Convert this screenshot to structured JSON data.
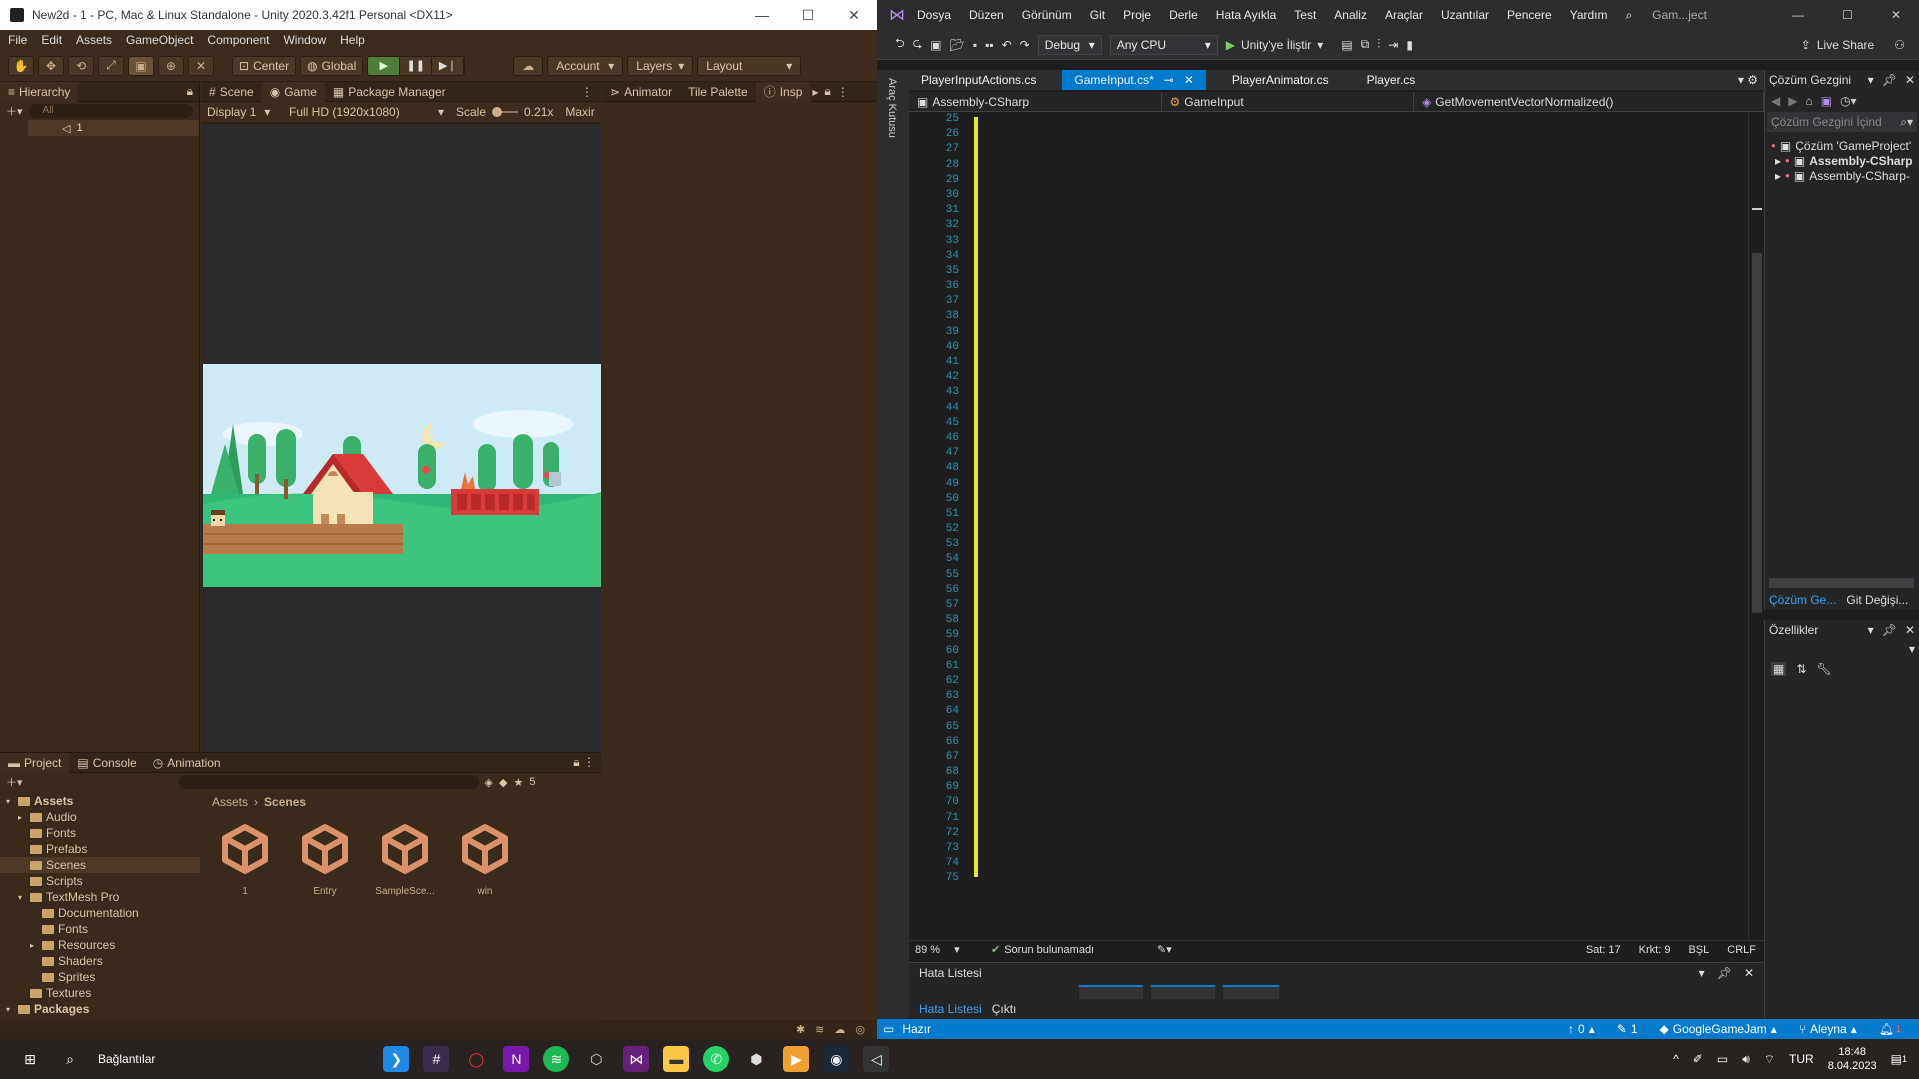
{
  "unity": {
    "title": "New2d - 1 - PC, Mac & Linux Standalone - Unity 2020.3.42f1 Personal <DX11>",
    "menu": [
      "File",
      "Edit",
      "Assets",
      "GameObject",
      "Component",
      "Window",
      "Help"
    ],
    "toolbar": {
      "center": "Center",
      "global": "Global",
      "account": "Account",
      "layers": "Layers",
      "layout": "Layout"
    },
    "hierarchy": {
      "tab": "Hierarchy",
      "search_placeholder": "All",
      "scene_item": "1"
    },
    "center_tabs": [
      "Scene",
      "Game",
      "Package Manager"
    ],
    "game_bar": {
      "display": "Display 1",
      "resolution": "Full HD (1920x1080)",
      "scale_label": "Scale",
      "scale_value": "0.21x",
      "maximize": "Maxir"
    },
    "right_tabs": [
      "Animator",
      "Tile Palette",
      "Insp"
    ],
    "bottom_tabs": [
      "Project",
      "Console",
      "Animation"
    ],
    "hidden_count": "5",
    "project_tree": [
      {
        "label": "Assets",
        "level": 0,
        "bold": true
      },
      {
        "label": "Audio",
        "level": 1
      },
      {
        "label": "Fonts",
        "level": 1
      },
      {
        "label": "Prefabs",
        "level": 1
      },
      {
        "label": "Scenes",
        "level": 1,
        "selected": true
      },
      {
        "label": "Scripts",
        "level": 1
      },
      {
        "label": "TextMesh Pro",
        "level": 1
      },
      {
        "label": "Documentation",
        "level": 2
      },
      {
        "label": "Fonts",
        "level": 2
      },
      {
        "label": "Resources",
        "level": 2
      },
      {
        "label": "Shaders",
        "level": 2
      },
      {
        "label": "Sprites",
        "level": 2
      },
      {
        "label": "Textures",
        "level": 1
      },
      {
        "label": "Packages",
        "level": 0,
        "bold": true
      }
    ],
    "breadcrumb": [
      "Assets",
      "Scenes"
    ],
    "scenes": [
      "1",
      "Entry",
      "SampleSce...",
      "win"
    ]
  },
  "vs": {
    "menu": [
      "Dosya",
      "Düzen",
      "Görünüm",
      "Git",
      "Proje",
      "Derle",
      "Hata Ayıkla",
      "Test",
      "Analiz",
      "Araçlar",
      "Uzantılar",
      "Pencere",
      "Yardım"
    ],
    "search_label": "Gam...ject",
    "config": "Debug",
    "platform": "Any CPU",
    "attach": "Unity'ye İliştir",
    "live_share": "Live Share",
    "toolbox": "Araç Kutusu",
    "doc_tabs": [
      {
        "label": "PlayerInputActions.cs",
        "selected": false
      },
      {
        "label": "GameInput.cs*",
        "selected": true
      },
      {
        "label": "PlayerAnimator.cs",
        "selected": false
      },
      {
        "label": "Player.cs",
        "selected": false
      }
    ],
    "nav": {
      "project": "Assembly-CSharp",
      "class": "GameInput",
      "member": "GetMovementVectorNormalized()"
    },
    "line_start": 25,
    "line_end": 75,
    "editor_status": {
      "zoom": "89 %",
      "issues": "Sorun bulunamadı",
      "line": "Sat: 17",
      "col": "Krkt: 9",
      "ins": "BŞL",
      "eol": "CRLF"
    },
    "error_panel": {
      "title": "Hata Listesi",
      "tabs": [
        "Hata Listesi",
        "Çıktı"
      ]
    },
    "status": {
      "ready": "Hazır",
      "up": "0",
      "pencil": "1",
      "repo": "GoogleGameJam",
      "branch": "Aleyna",
      "notif": "1"
    },
    "solution": {
      "title": "Çözüm Gezgini",
      "search_placeholder": "Çözüm Gezgini İçind",
      "items": [
        "Çözüm 'GameProject'",
        "Assembly-CSharp",
        "Assembly-CSharp-"
      ],
      "bottom_tabs": [
        "Çözüm Ge...",
        "Git Değişi..."
      ]
    },
    "properties": {
      "title": "Özellikler"
    }
  },
  "taskbar": {
    "search_text": "Bağlantılar",
    "lang": "TUR",
    "time": "18:48",
    "date": "8.04.2023",
    "notif_count": "1"
  },
  "colors": {
    "unity_bg": "#3a2b1c",
    "vs_accent": "#007acc",
    "grass": "#2fb875",
    "roof": "#d93a3a"
  }
}
